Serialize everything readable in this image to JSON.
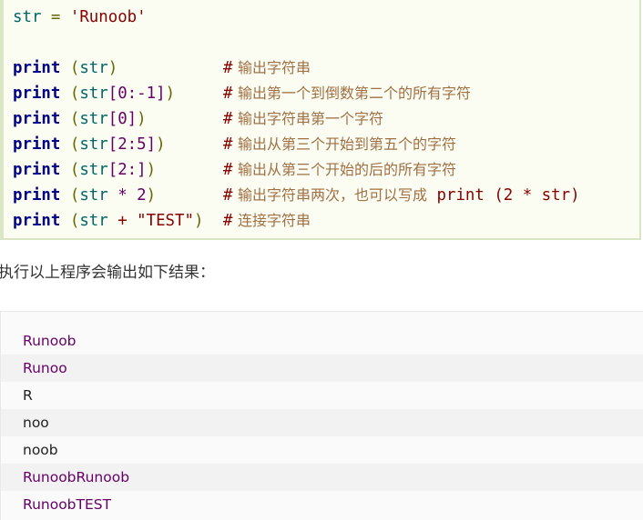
{
  "code": {
    "assign": {
      "var": "str",
      "op": " = ",
      "value": "'Runoob'"
    },
    "lines": [
      {
        "kw": "print",
        "args_before": " (",
        "var": "str",
        "slice": "",
        "args_after": ")",
        "comment_hash": "#",
        "comment": "输出字符串"
      },
      {
        "kw": "print",
        "args_before": " (",
        "var": "str",
        "slice": "[0:-1]",
        "args_after": ")",
        "comment_hash": "#",
        "comment": "输出第一个到倒数第二个的所有字符"
      },
      {
        "kw": "print",
        "args_before": " (",
        "var": "str",
        "slice": "[0]",
        "args_after": ")",
        "comment_hash": "#",
        "comment": "输出字符串第一个字符"
      },
      {
        "kw": "print",
        "args_before": " (",
        "var": "str",
        "slice": "[2:5]",
        "args_after": ")",
        "comment_hash": "#",
        "comment": "输出从第三个开始到第五个的字符"
      },
      {
        "kw": "print",
        "args_before": " (",
        "var": "str",
        "slice": "[2:]",
        "args_after": ")",
        "comment_hash": "#",
        "comment": "输出从第三个开始的后的所有字符"
      },
      {
        "kw": "print",
        "args_before": " (",
        "var": "str",
        "slice": " * 2",
        "args_after": ")",
        "comment_hash": "#",
        "comment": "输出字符串两次，也可以写成",
        "comment_code": " print (2 * str)"
      },
      {
        "kw": "print",
        "args_before": " (",
        "var": "str",
        "slice": " + \"TEST\"",
        "args_after": ")",
        "comment_hash": "#",
        "comment": "连接字符串"
      }
    ]
  },
  "intro_text": "执行以上程序会输出如下结果：",
  "output_lines": [
    "Runoob",
    "Runoo",
    "R",
    "noo",
    "noob",
    "RunoobRunoob",
    "RunoobTEST"
  ],
  "colors": {
    "keyword": "#000088",
    "string": "#880000",
    "comment": "#a07044",
    "output_purple": "#660066",
    "code_bg": "#fbfdf3",
    "code_border": "#d9e5c4"
  }
}
